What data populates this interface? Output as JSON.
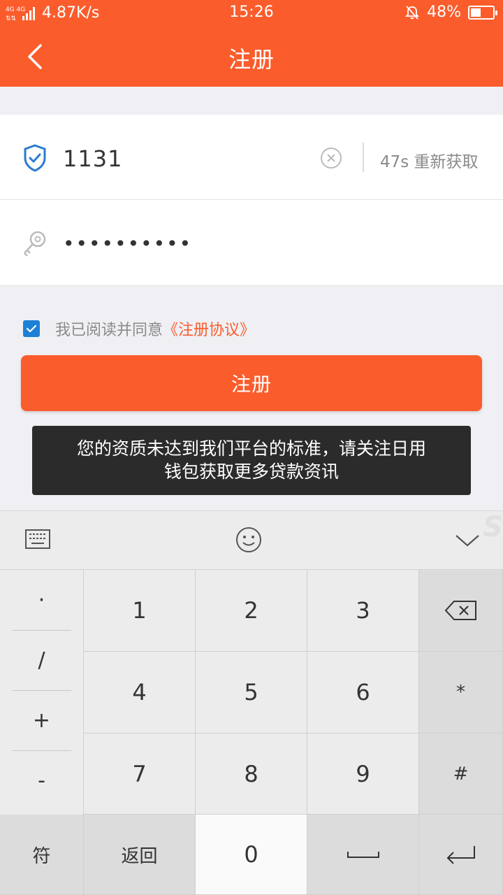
{
  "status_bar": {
    "network": "4G 4G",
    "speed": "4.87K/s",
    "time": "15:26",
    "battery": "48%",
    "battery_level": 0.48
  },
  "nav": {
    "title": "注册"
  },
  "form": {
    "code_value": "1131",
    "resend_label": "47s 重新获取",
    "password_value": "••••••••••"
  },
  "agreement": {
    "checked": true,
    "text": "我已阅读并同意",
    "link": "《注册协议》"
  },
  "register_button": "注册",
  "toast": {
    "line1": "您的资质未达到我们平台的标准，请关注日用",
    "line2": "钱包获取更多贷款资讯"
  },
  "keyboard": {
    "watermark": "S",
    "symbols": [
      "·",
      "/",
      "+",
      "-"
    ],
    "digits": [
      "1",
      "2",
      "3",
      "4",
      "5",
      "6",
      "7",
      "8",
      "9",
      "0"
    ],
    "star": "*",
    "hash": "#",
    "fu": "符",
    "back": "返回"
  },
  "colors": {
    "accent": "#fb5c2c",
    "checkbox": "#1e7fd6",
    "shield_icon": "#2a7bd0"
  }
}
